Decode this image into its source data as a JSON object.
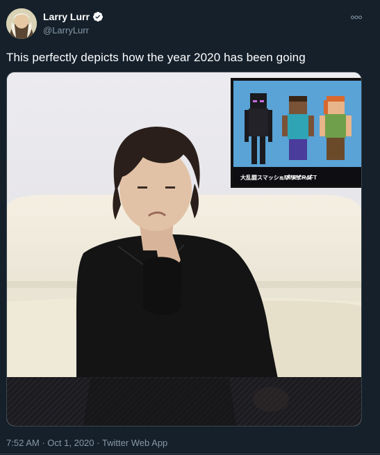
{
  "tweet": {
    "display_name": "Larry Lurr",
    "handle": "@LarryLurr",
    "text": "This perfectly depicts how the year 2020 has been going",
    "time": "7:52 AM",
    "date": "Oct 1, 2020",
    "source": "Twitter Web App",
    "separator": "·"
  },
  "media": {
    "poster_logo_text": "大乱闘スマッシュブラザーズ",
    "poster_text": "× MINECRAFT"
  },
  "icons": {
    "verified": "verified-badge-icon",
    "more": "more-horizontal-icon"
  },
  "colors": {
    "background": "#15202b",
    "secondary_text": "#8899a6",
    "border": "#38444d",
    "verified": "#ffffff"
  }
}
